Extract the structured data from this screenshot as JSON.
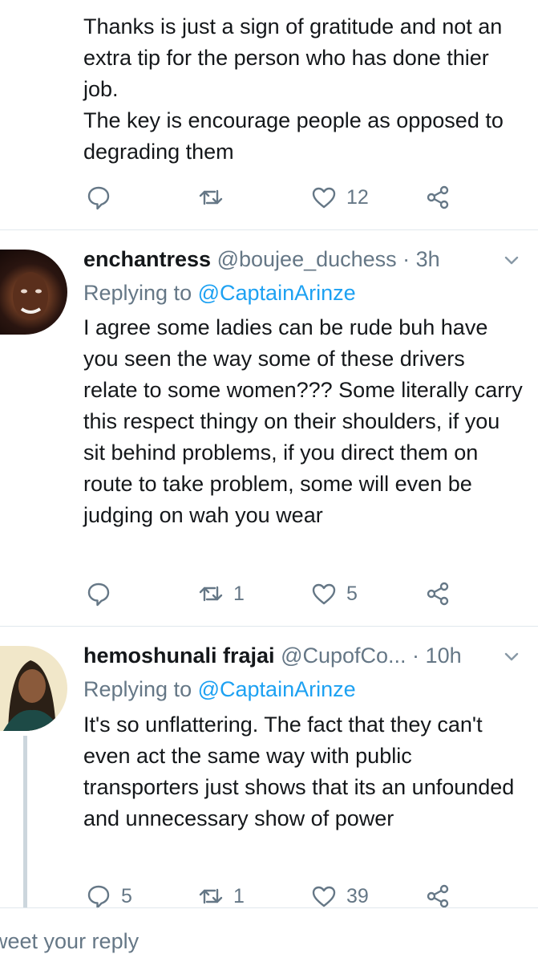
{
  "tweets": [
    {
      "body_lines": [
        "Thanks is just a sign of gratitude  and not an extra tip for the person who has done thier job.",
        "The key is encourage people as opposed to degrading  them"
      ],
      "retweets": "",
      "likes": "12",
      "replies": ""
    },
    {
      "name": "enchantress",
      "handle": "@boujee_duchess · 3h",
      "replying_label": "Replying to",
      "replying_to": "@CaptainArinze",
      "body": "I agree some ladies can be rude buh have you seen the way some of these drivers relate to some women??? Some literally carry this respect thingy on their shoulders, if you sit behind problems, if you direct them on route to take problem, some will even be judging on wah you wear",
      "replies": "",
      "retweets": "1",
      "likes": "5"
    },
    {
      "name": "hemoshunali frajai",
      "handle": "@CupofCo... · 10h",
      "replying_label": "Replying to",
      "replying_to": "@CaptainArinze",
      "body": "It's so unflattering. The fact that they can't even act the same way with public transporters just shows that its an unfounded and unnecessary show of power",
      "replies": "5",
      "retweets": "1",
      "likes": "39"
    }
  ],
  "compose_placeholder": "weet your reply",
  "icons": {
    "reply": "reply-icon",
    "retweet": "retweet-icon",
    "like": "heart-icon",
    "share": "share-icon",
    "menu": "chevron-down-icon"
  },
  "colors": {
    "link": "#1da1f2",
    "muted": "#657786",
    "divider": "#e1e8ed"
  }
}
